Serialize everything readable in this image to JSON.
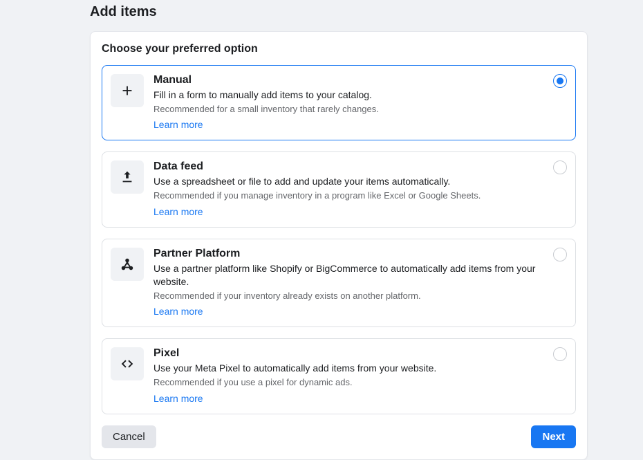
{
  "pageTitle": "Add items",
  "cardTitle": "Choose your preferred option",
  "options": [
    {
      "id": "manual",
      "title": "Manual",
      "desc": "Fill in a form to manually add items to your catalog.",
      "reco": "Recommended for a small inventory that rarely changes.",
      "link": "Learn more",
      "selected": true
    },
    {
      "id": "datafeed",
      "title": "Data feed",
      "desc": "Use a spreadsheet or file to add and update your items automatically.",
      "reco": "Recommended if you manage inventory in a program like Excel or Google Sheets.",
      "link": "Learn more",
      "selected": false
    },
    {
      "id": "partner",
      "title": "Partner Platform",
      "desc": "Use a partner platform like Shopify or BigCommerce to automatically add items from your website.",
      "reco": "Recommended if your inventory already exists on another platform.",
      "link": "Learn more",
      "selected": false
    },
    {
      "id": "pixel",
      "title": "Pixel",
      "desc": "Use your Meta Pixel to automatically add items from your website.",
      "reco": "Recommended if you use a pixel for dynamic ads.",
      "link": "Learn more",
      "selected": false
    }
  ],
  "buttons": {
    "cancel": "Cancel",
    "next": "Next"
  }
}
